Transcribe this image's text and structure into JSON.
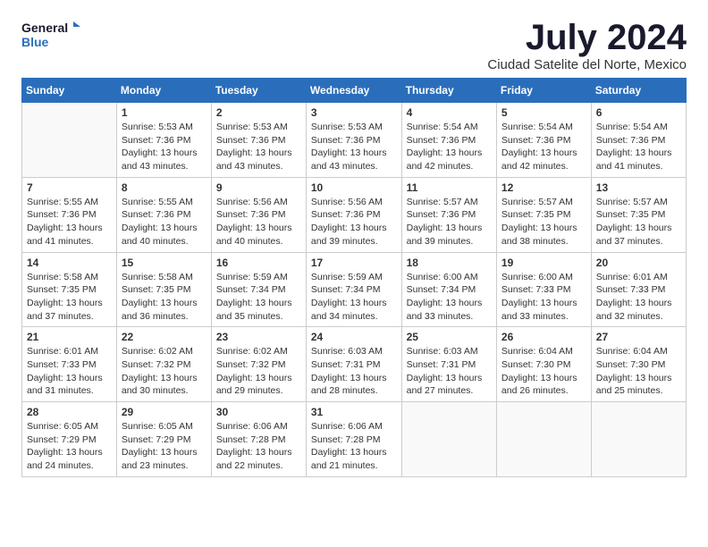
{
  "logo": {
    "line1": "General",
    "line2": "Blue"
  },
  "title": "July 2024",
  "location": "Ciudad Satelite del Norte, Mexico",
  "days_of_week": [
    "Sunday",
    "Monday",
    "Tuesday",
    "Wednesday",
    "Thursday",
    "Friday",
    "Saturday"
  ],
  "weeks": [
    [
      {
        "day": "",
        "lines": []
      },
      {
        "day": "1",
        "lines": [
          "Sunrise: 5:53 AM",
          "Sunset: 7:36 PM",
          "Daylight: 13 hours",
          "and 43 minutes."
        ]
      },
      {
        "day": "2",
        "lines": [
          "Sunrise: 5:53 AM",
          "Sunset: 7:36 PM",
          "Daylight: 13 hours",
          "and 43 minutes."
        ]
      },
      {
        "day": "3",
        "lines": [
          "Sunrise: 5:53 AM",
          "Sunset: 7:36 PM",
          "Daylight: 13 hours",
          "and 43 minutes."
        ]
      },
      {
        "day": "4",
        "lines": [
          "Sunrise: 5:54 AM",
          "Sunset: 7:36 PM",
          "Daylight: 13 hours",
          "and 42 minutes."
        ]
      },
      {
        "day": "5",
        "lines": [
          "Sunrise: 5:54 AM",
          "Sunset: 7:36 PM",
          "Daylight: 13 hours",
          "and 42 minutes."
        ]
      },
      {
        "day": "6",
        "lines": [
          "Sunrise: 5:54 AM",
          "Sunset: 7:36 PM",
          "Daylight: 13 hours",
          "and 41 minutes."
        ]
      }
    ],
    [
      {
        "day": "7",
        "lines": [
          "Sunrise: 5:55 AM",
          "Sunset: 7:36 PM",
          "Daylight: 13 hours",
          "and 41 minutes."
        ]
      },
      {
        "day": "8",
        "lines": [
          "Sunrise: 5:55 AM",
          "Sunset: 7:36 PM",
          "Daylight: 13 hours",
          "and 40 minutes."
        ]
      },
      {
        "day": "9",
        "lines": [
          "Sunrise: 5:56 AM",
          "Sunset: 7:36 PM",
          "Daylight: 13 hours",
          "and 40 minutes."
        ]
      },
      {
        "day": "10",
        "lines": [
          "Sunrise: 5:56 AM",
          "Sunset: 7:36 PM",
          "Daylight: 13 hours",
          "and 39 minutes."
        ]
      },
      {
        "day": "11",
        "lines": [
          "Sunrise: 5:57 AM",
          "Sunset: 7:36 PM",
          "Daylight: 13 hours",
          "and 39 minutes."
        ]
      },
      {
        "day": "12",
        "lines": [
          "Sunrise: 5:57 AM",
          "Sunset: 7:35 PM",
          "Daylight: 13 hours",
          "and 38 minutes."
        ]
      },
      {
        "day": "13",
        "lines": [
          "Sunrise: 5:57 AM",
          "Sunset: 7:35 PM",
          "Daylight: 13 hours",
          "and 37 minutes."
        ]
      }
    ],
    [
      {
        "day": "14",
        "lines": [
          "Sunrise: 5:58 AM",
          "Sunset: 7:35 PM",
          "Daylight: 13 hours",
          "and 37 minutes."
        ]
      },
      {
        "day": "15",
        "lines": [
          "Sunrise: 5:58 AM",
          "Sunset: 7:35 PM",
          "Daylight: 13 hours",
          "and 36 minutes."
        ]
      },
      {
        "day": "16",
        "lines": [
          "Sunrise: 5:59 AM",
          "Sunset: 7:34 PM",
          "Daylight: 13 hours",
          "and 35 minutes."
        ]
      },
      {
        "day": "17",
        "lines": [
          "Sunrise: 5:59 AM",
          "Sunset: 7:34 PM",
          "Daylight: 13 hours",
          "and 34 minutes."
        ]
      },
      {
        "day": "18",
        "lines": [
          "Sunrise: 6:00 AM",
          "Sunset: 7:34 PM",
          "Daylight: 13 hours",
          "and 33 minutes."
        ]
      },
      {
        "day": "19",
        "lines": [
          "Sunrise: 6:00 AM",
          "Sunset: 7:33 PM",
          "Daylight: 13 hours",
          "and 33 minutes."
        ]
      },
      {
        "day": "20",
        "lines": [
          "Sunrise: 6:01 AM",
          "Sunset: 7:33 PM",
          "Daylight: 13 hours",
          "and 32 minutes."
        ]
      }
    ],
    [
      {
        "day": "21",
        "lines": [
          "Sunrise: 6:01 AM",
          "Sunset: 7:33 PM",
          "Daylight: 13 hours",
          "and 31 minutes."
        ]
      },
      {
        "day": "22",
        "lines": [
          "Sunrise: 6:02 AM",
          "Sunset: 7:32 PM",
          "Daylight: 13 hours",
          "and 30 minutes."
        ]
      },
      {
        "day": "23",
        "lines": [
          "Sunrise: 6:02 AM",
          "Sunset: 7:32 PM",
          "Daylight: 13 hours",
          "and 29 minutes."
        ]
      },
      {
        "day": "24",
        "lines": [
          "Sunrise: 6:03 AM",
          "Sunset: 7:31 PM",
          "Daylight: 13 hours",
          "and 28 minutes."
        ]
      },
      {
        "day": "25",
        "lines": [
          "Sunrise: 6:03 AM",
          "Sunset: 7:31 PM",
          "Daylight: 13 hours",
          "and 27 minutes."
        ]
      },
      {
        "day": "26",
        "lines": [
          "Sunrise: 6:04 AM",
          "Sunset: 7:30 PM",
          "Daylight: 13 hours",
          "and 26 minutes."
        ]
      },
      {
        "day": "27",
        "lines": [
          "Sunrise: 6:04 AM",
          "Sunset: 7:30 PM",
          "Daylight: 13 hours",
          "and 25 minutes."
        ]
      }
    ],
    [
      {
        "day": "28",
        "lines": [
          "Sunrise: 6:05 AM",
          "Sunset: 7:29 PM",
          "Daylight: 13 hours",
          "and 24 minutes."
        ]
      },
      {
        "day": "29",
        "lines": [
          "Sunrise: 6:05 AM",
          "Sunset: 7:29 PM",
          "Daylight: 13 hours",
          "and 23 minutes."
        ]
      },
      {
        "day": "30",
        "lines": [
          "Sunrise: 6:06 AM",
          "Sunset: 7:28 PM",
          "Daylight: 13 hours",
          "and 22 minutes."
        ]
      },
      {
        "day": "31",
        "lines": [
          "Sunrise: 6:06 AM",
          "Sunset: 7:28 PM",
          "Daylight: 13 hours",
          "and 21 minutes."
        ]
      },
      {
        "day": "",
        "lines": []
      },
      {
        "day": "",
        "lines": []
      },
      {
        "day": "",
        "lines": []
      }
    ]
  ]
}
